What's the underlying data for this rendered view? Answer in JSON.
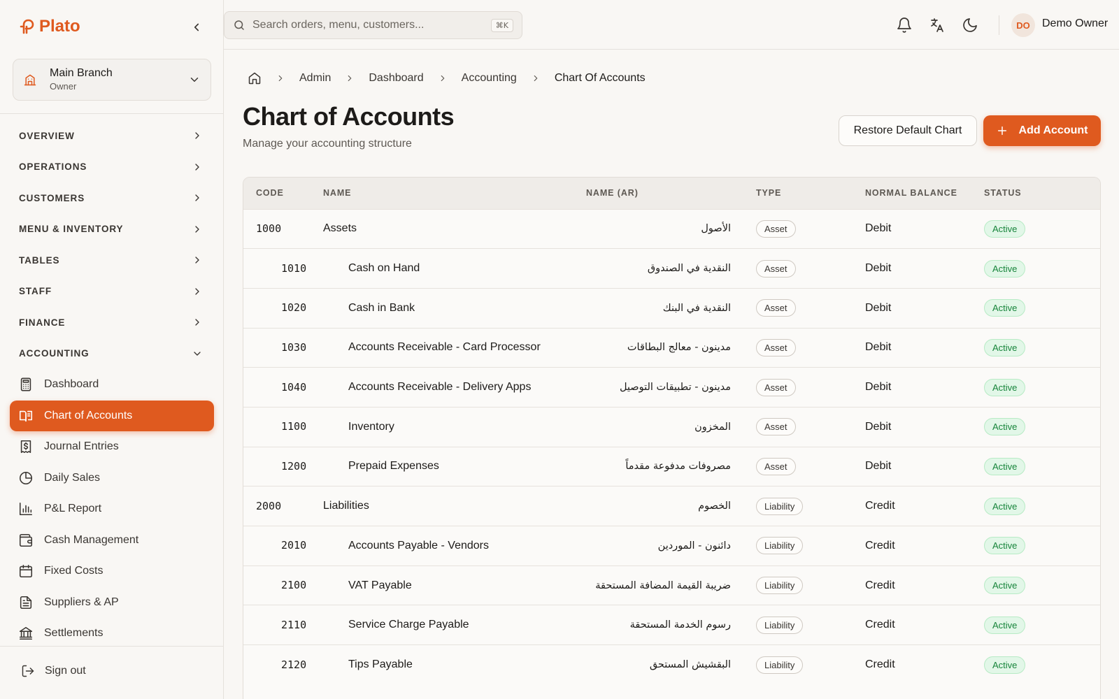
{
  "app": {
    "name": "Plato"
  },
  "branch": {
    "name": "Main Branch",
    "role": "Owner"
  },
  "nav": {
    "groups": [
      {
        "label": "OVERVIEW"
      },
      {
        "label": "OPERATIONS"
      },
      {
        "label": "CUSTOMERS"
      },
      {
        "label": "MENU & INVENTORY"
      },
      {
        "label": "TABLES"
      },
      {
        "label": "STAFF"
      },
      {
        "label": "FINANCE"
      },
      {
        "label": "ACCOUNTING"
      }
    ],
    "accounting_items": [
      {
        "label": "Dashboard",
        "icon": "calculator-icon"
      },
      {
        "label": "Chart of Accounts",
        "icon": "book-open-icon"
      },
      {
        "label": "Journal Entries",
        "icon": "receipt-dollar-icon"
      },
      {
        "label": "Daily Sales",
        "icon": "pie-chart-icon"
      },
      {
        "label": "P&L Report",
        "icon": "bar-chart-icon"
      },
      {
        "label": "Cash Management",
        "icon": "wallet-icon"
      },
      {
        "label": "Fixed Costs",
        "icon": "calendar-icon"
      },
      {
        "label": "Suppliers & AP",
        "icon": "document-icon"
      },
      {
        "label": "Settlements",
        "icon": "bank-icon"
      }
    ],
    "sign_out": "Sign out"
  },
  "search": {
    "placeholder": "Search orders, menu, customers...",
    "shortcut": "⌘K"
  },
  "user": {
    "initials": "DO",
    "name": "Demo Owner"
  },
  "breadcrumb": {
    "items": [
      "Admin",
      "Dashboard",
      "Accounting"
    ],
    "current": "Chart Of Accounts"
  },
  "page": {
    "title": "Chart of Accounts",
    "subtitle": "Manage your accounting structure",
    "restore_label": "Restore Default Chart",
    "add_label": "Add Account"
  },
  "table": {
    "headers": {
      "code": "CODE",
      "name": "NAME",
      "name_ar": "NAME (AR)",
      "type": "TYPE",
      "balance": "NORMAL BALANCE",
      "status": "STATUS"
    },
    "rows": [
      {
        "code": "1000",
        "name": "Assets",
        "name_ar": "الأصول",
        "type": "Asset",
        "balance": "Debit",
        "status": "Active",
        "level": 0
      },
      {
        "code": "1010",
        "name": "Cash on Hand",
        "name_ar": "النقدية في الصندوق",
        "type": "Asset",
        "balance": "Debit",
        "status": "Active",
        "level": 1
      },
      {
        "code": "1020",
        "name": "Cash in Bank",
        "name_ar": "النقدية في البنك",
        "type": "Asset",
        "balance": "Debit",
        "status": "Active",
        "level": 1
      },
      {
        "code": "1030",
        "name": "Accounts Receivable - Card Processor",
        "name_ar": "مدينون - معالج البطاقات",
        "type": "Asset",
        "balance": "Debit",
        "status": "Active",
        "level": 1
      },
      {
        "code": "1040",
        "name": "Accounts Receivable - Delivery Apps",
        "name_ar": "مدينون - تطبيقات التوصيل",
        "type": "Asset",
        "balance": "Debit",
        "status": "Active",
        "level": 1
      },
      {
        "code": "1100",
        "name": "Inventory",
        "name_ar": "المخزون",
        "type": "Asset",
        "balance": "Debit",
        "status": "Active",
        "level": 1
      },
      {
        "code": "1200",
        "name": "Prepaid Expenses",
        "name_ar": "مصروفات مدفوعة مقدماً",
        "type": "Asset",
        "balance": "Debit",
        "status": "Active",
        "level": 1
      },
      {
        "code": "2000",
        "name": "Liabilities",
        "name_ar": "الخصوم",
        "type": "Liability",
        "balance": "Credit",
        "status": "Active",
        "level": 0
      },
      {
        "code": "2010",
        "name": "Accounts Payable - Vendors",
        "name_ar": "دائنون - الموردين",
        "type": "Liability",
        "balance": "Credit",
        "status": "Active",
        "level": 1
      },
      {
        "code": "2100",
        "name": "VAT Payable",
        "name_ar": "ضريبة القيمة المضافة المستحقة",
        "type": "Liability",
        "balance": "Credit",
        "status": "Active",
        "level": 1
      },
      {
        "code": "2110",
        "name": "Service Charge Payable",
        "name_ar": "رسوم الخدمة المستحقة",
        "type": "Liability",
        "balance": "Credit",
        "status": "Active",
        "level": 1
      },
      {
        "code": "2120",
        "name": "Tips Payable",
        "name_ar": "البقشيش المستحق",
        "type": "Liability",
        "balance": "Credit",
        "status": "Active",
        "level": 1
      }
    ]
  },
  "colors": {
    "accent": "#df5a1f",
    "active_green": "#16843a",
    "active_bg": "#e2f7e8"
  }
}
